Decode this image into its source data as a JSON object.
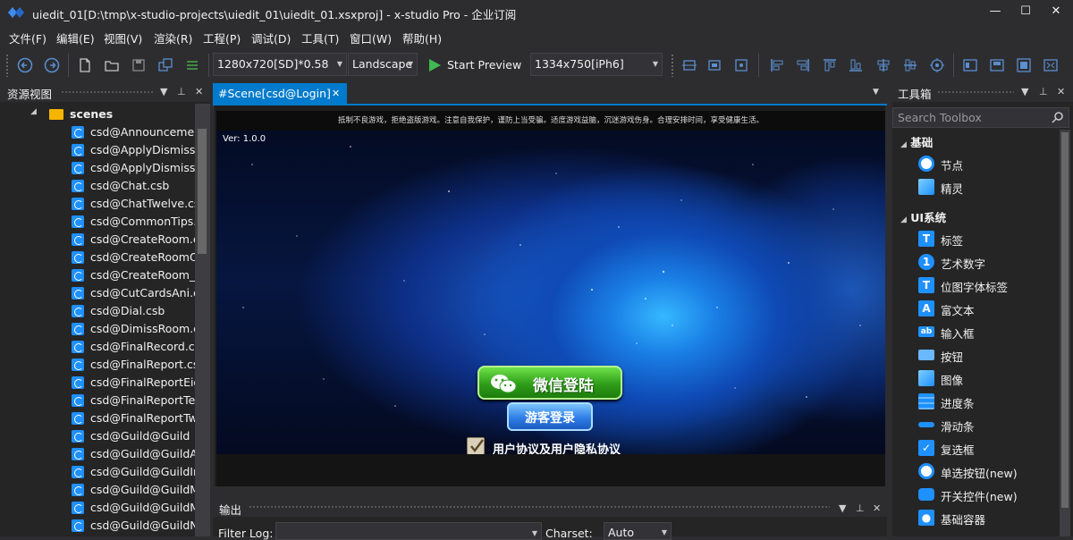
{
  "window": {
    "title": "uiedit_01[D:\\tmp\\x-studio-projects\\uiedit_01\\uiedit_01.xsxproj] - x-studio Pro - 企业订阅",
    "minimize_glyph": "—",
    "maximize_glyph": "☐",
    "close_glyph": "✕"
  },
  "menu": [
    "文件(F)",
    "编辑(E)",
    "视图(V)",
    "渲染(R)",
    "工程(P)",
    "调试(D)",
    "工具(T)",
    "窗口(W)",
    "帮助(H)"
  ],
  "toolbar": {
    "resolution": "1280x720[SD]*0.58",
    "orientation": "Landscape",
    "start_preview": "Start Preview",
    "device": "1334x750[iPh6]"
  },
  "left_panel": {
    "title": "资源视图",
    "tree_root": "scenes",
    "files": [
      "csd@Announcement",
      "csd@ApplyDismissRoom",
      "csd@ApplyDismissRoomEight",
      "csd@Chat.csb",
      "csd@ChatTwelve.csb",
      "csd@CommonTips.csb",
      "csd@CreateRoom.csb",
      "csd@CreateRoomOne",
      "csd@CreateRoom_S",
      "csd@CutCardsAni.csb",
      "csd@Dial.csb",
      "csd@DimissRoom.csb",
      "csd@FinalRecord.csb",
      "csd@FinalReport.csb",
      "csd@FinalReportEight",
      "csd@FinalReportTen",
      "csd@FinalReportTwelve",
      "csd@Guild@Guild",
      "csd@Guild@GuildApply",
      "csd@Guild@GuildInfo",
      "csd@Guild@GuildMember",
      "csd@Guild@GuildManager",
      "csd@Guild@GuildNotice"
    ]
  },
  "document": {
    "tab_label": "#Scene[csd@Login]",
    "scene": {
      "notice": "抵制不良游戏，拒绝盗版游戏。注意自我保护，谨防上当受骗。适度游戏益脑，沉迷游戏伤身。合理安排时间，享受健康生活。",
      "version": "Ver: 1.0.0",
      "wechat_login": "微信登陆",
      "guest_login": "游客登录",
      "agreement": "用户协议及用户隐私协议"
    }
  },
  "output_panel": {
    "title": "输出",
    "filter_label": "Filter Log:",
    "charset_label": "Charset:",
    "charset_value": "Auto"
  },
  "toolbox": {
    "title": "工具箱",
    "search_placeholder": "Search Toolbox",
    "categories": [
      {
        "name": "基础",
        "items": [
          {
            "label": "节点",
            "icon": "node-icon"
          },
          {
            "label": "精灵",
            "icon": "sprite-icon"
          }
        ]
      },
      {
        "name": "UI系统",
        "items": [
          {
            "label": "标签",
            "icon": "text-label-icon"
          },
          {
            "label": "艺术数字",
            "icon": "art-number-icon"
          },
          {
            "label": "位图字体标签",
            "icon": "bitmap-font-icon"
          },
          {
            "label": "富文本",
            "icon": "rich-text-icon"
          },
          {
            "label": "输入框",
            "icon": "input-box-icon"
          },
          {
            "label": "按钮",
            "icon": "button-icon"
          },
          {
            "label": "图像",
            "icon": "image-icon"
          },
          {
            "label": "进度条",
            "icon": "progress-bar-icon"
          },
          {
            "label": "滑动条",
            "icon": "slider-icon"
          },
          {
            "label": "复选框",
            "icon": "checkbox-icon"
          },
          {
            "label": "单选按钮(new)",
            "icon": "radio-button-icon"
          },
          {
            "label": "开关控件(new)",
            "icon": "switch-icon"
          },
          {
            "label": "基础容器",
            "icon": "container-icon"
          }
        ]
      }
    ]
  },
  "colors": {
    "accent": "#007acc",
    "file_icon": "#1e90ff",
    "folder": "#f5b400",
    "play_green": "#3fb950"
  }
}
